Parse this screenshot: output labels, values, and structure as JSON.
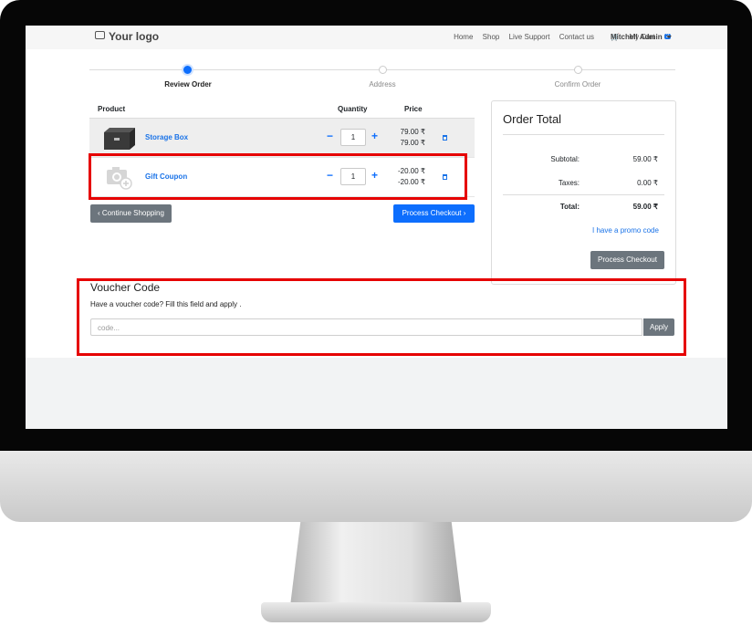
{
  "navbar": {
    "logo": "Your logo",
    "links": [
      "Home",
      "Shop",
      "Live Support",
      "Contact us"
    ],
    "cart_label": "My Cart",
    "cart_count": "2",
    "user": "Mitchell Admin"
  },
  "steps": [
    {
      "label": "Review Order",
      "active": true
    },
    {
      "label": "Address",
      "active": false
    },
    {
      "label": "Confirm Order",
      "active": false
    }
  ],
  "cart_table": {
    "headers": {
      "product": "Product",
      "quantity": "Quantity",
      "price": "Price"
    },
    "rows": [
      {
        "name": "Storage Box",
        "quantity": "1",
        "price": "79.00 ₹",
        "price_line2": "79.00 ₹"
      },
      {
        "name": "Gift Coupon",
        "quantity": "1",
        "price": "-20.00 ₹",
        "price_line2": "-20.00 ₹"
      }
    ],
    "minus_glyph": "−",
    "plus_glyph": "+"
  },
  "buttons": {
    "continue_shopping": "‹ Continue Shopping",
    "process_checkout": "Process Checkout ›",
    "process_checkout_card": "Process Checkout",
    "apply": "Apply"
  },
  "order_total": {
    "title": "Order Total",
    "subtotal_label": "Subtotal:",
    "subtotal_value": "59.00 ₹",
    "taxes_label": "Taxes:",
    "taxes_value": "0.00 ₹",
    "total_label": "Total:",
    "total_value": "59.00 ₹",
    "promo_link": "I have a promo code"
  },
  "voucher": {
    "title": "Voucher Code",
    "description": "Have a voucher code? Fill this field and apply .",
    "placeholder": "code..."
  },
  "colors": {
    "accent": "#0d6efd",
    "link": "#1a73e8",
    "highlight": "#e60000",
    "secondary_button": "#6c757d"
  },
  "icons": [
    "camera-logo-icon",
    "cart-icon",
    "caret-down-icon",
    "storage-box-image",
    "gift-coupon-camera-icon",
    "trash-icon",
    "chevron-left-icon",
    "chevron-right-icon"
  ]
}
